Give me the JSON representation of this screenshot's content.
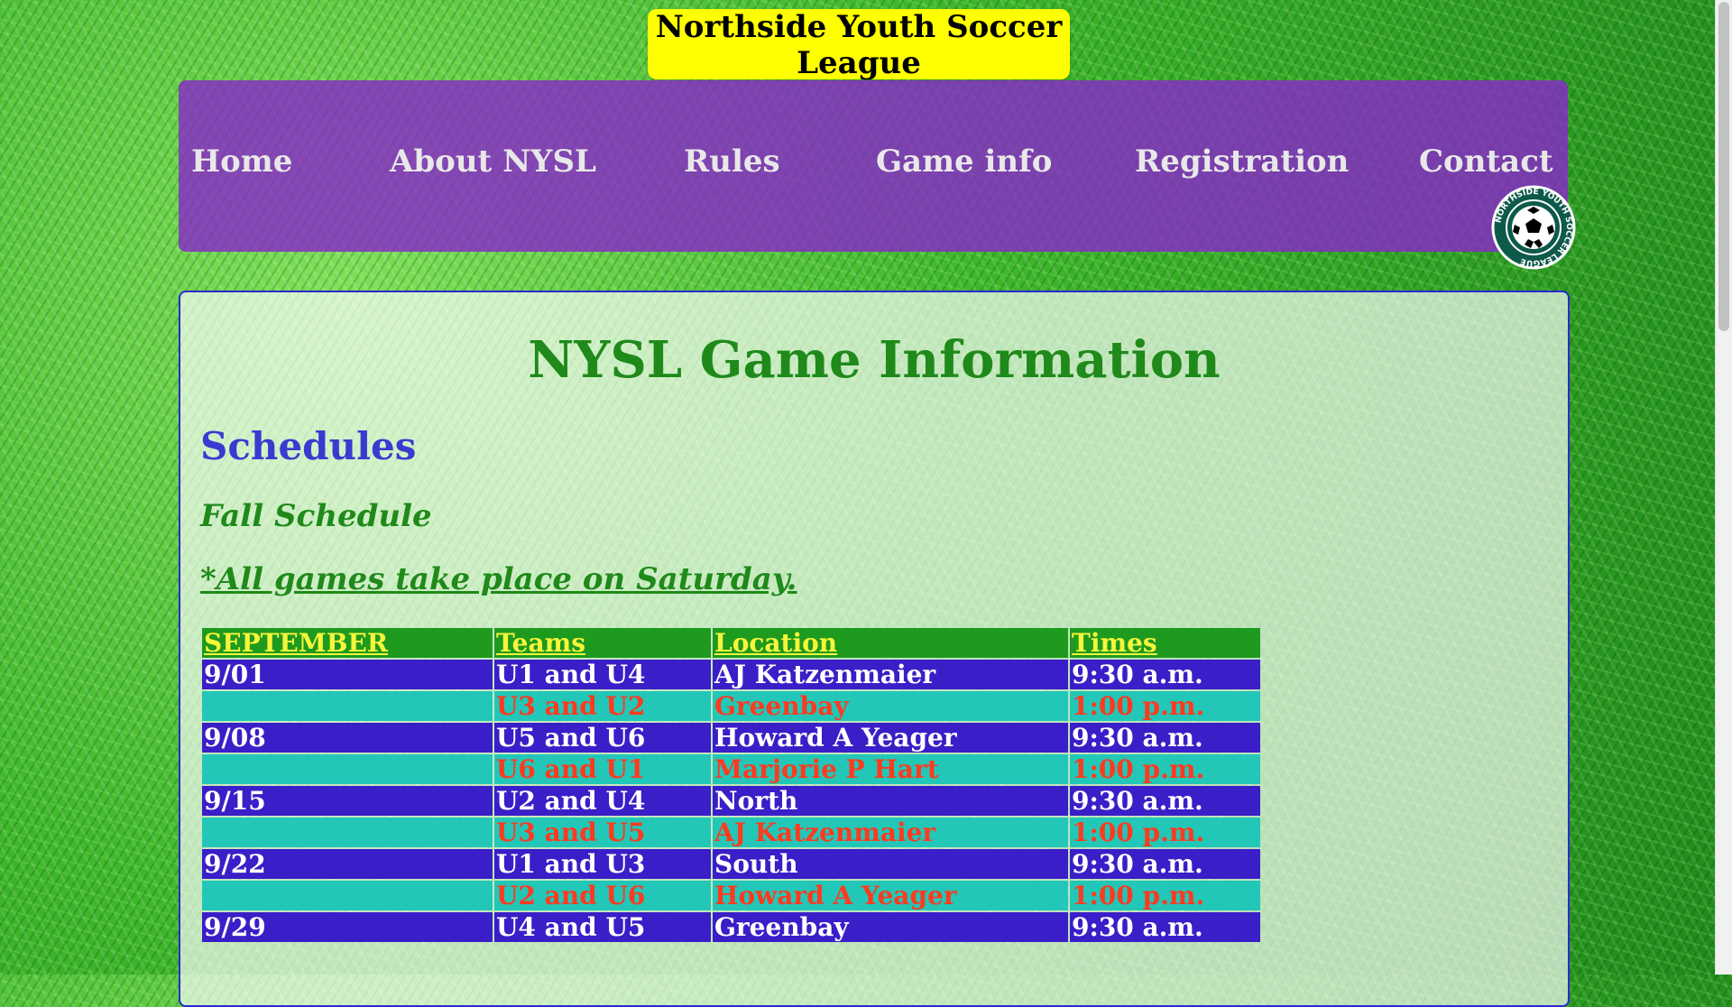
{
  "header": {
    "title": "Northside Youth Soccer League"
  },
  "nav": {
    "items": [
      {
        "label": "Home"
      },
      {
        "label": "About NYSL"
      },
      {
        "label": "Rules"
      },
      {
        "label": "Game info"
      },
      {
        "label": "Registration"
      },
      {
        "label": "Contact"
      }
    ]
  },
  "logo": {
    "text": "NORTHSIDE YOUTH SOCCER LEAGUE",
    "icon": "soccer-ball-icon"
  },
  "main": {
    "title": "NYSL Game Information",
    "section_title": "Schedules",
    "subtitle": "Fall Schedule",
    "note": "*All games take place on Saturday."
  },
  "schedule": {
    "headers": [
      "SEPTEMBER",
      "Teams",
      "Location",
      "Times"
    ],
    "rows": [
      {
        "date": "9/01",
        "teams": "U1 and U4",
        "location": "AJ Katzenmaier",
        "time": "9:30 a.m."
      },
      {
        "date": "",
        "teams": "U3 and U2",
        "location": "Greenbay",
        "time": "1:00 p.m."
      },
      {
        "date": "9/08",
        "teams": "U5 and U6",
        "location": "Howard A Yeager",
        "time": "9:30 a.m."
      },
      {
        "date": "",
        "teams": "U6 and U1",
        "location": "Marjorie P Hart",
        "time": "1:00 p.m."
      },
      {
        "date": "9/15",
        "teams": "U2 and U4",
        "location": "North",
        "time": "9:30 a.m."
      },
      {
        "date": "",
        "teams": "U3 and U5",
        "location": "AJ Katzenmaier",
        "time": "1:00 p.m."
      },
      {
        "date": "9/22",
        "teams": "U1 and U3",
        "location": "South",
        "time": "9:30 a.m."
      },
      {
        "date": "",
        "teams": "U2 and U6",
        "location": "Howard A Yeager",
        "time": "1:00 p.m."
      },
      {
        "date": "9/29",
        "teams": "U4 and U5",
        "location": "Greenbay",
        "time": "9:30 a.m."
      }
    ]
  },
  "colors": {
    "banner": "#ffff00",
    "nav": "#8728c8",
    "title_green": "#1f8a1a",
    "section_blue": "#3a3ad0",
    "row_purple": "#3a1ec8",
    "row_teal": "#22c7b8",
    "row_orange_text": "#ff3a1f",
    "header_green": "#1e9a1e",
    "header_yellow_text": "#f6f63a"
  }
}
